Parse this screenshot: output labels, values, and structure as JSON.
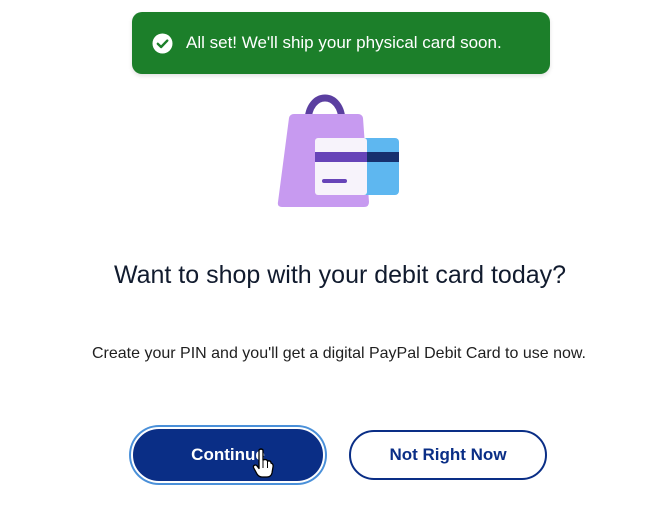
{
  "toast": {
    "icon": "check-circle-icon",
    "message": "All set! We'll ship your physical card soon.",
    "color": "#1c7f2a"
  },
  "illustration": {
    "icon": "shopping-bag-with-card-icon"
  },
  "main": {
    "headline": "Want to shop with your debit card today?",
    "description": "Create your PIN and you'll get a digital PayPal Debit Card to use now."
  },
  "actions": {
    "continue_label": "Continue",
    "decline_label": "Not Right Now"
  },
  "colors": {
    "primary": "#0a2e86",
    "focus_ring": "#4a90d9",
    "bag": "#c79af0",
    "card_blue": "#5eb7f0"
  }
}
